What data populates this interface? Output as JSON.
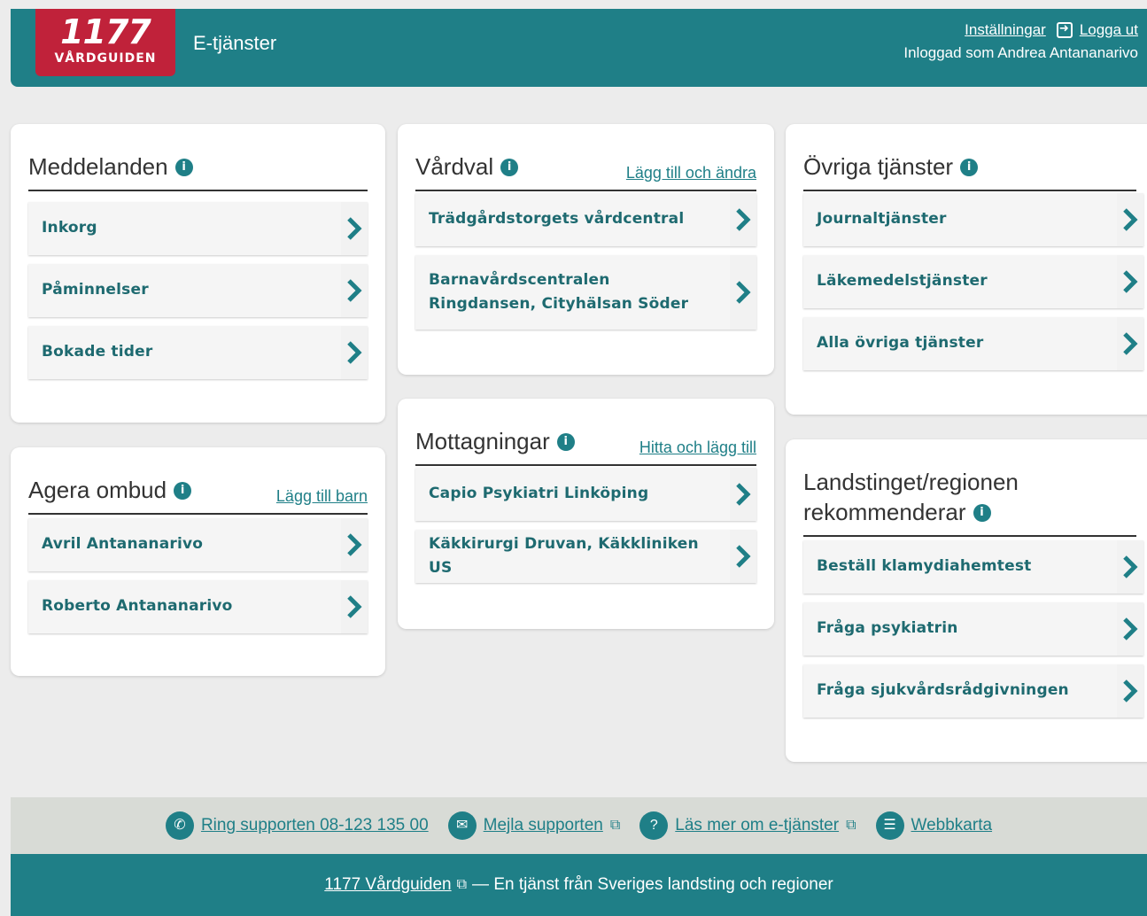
{
  "header": {
    "logo_number": "1177",
    "logo_text": "VÅRDGUIDEN",
    "app_title": "E-tjänster",
    "settings_link": "Inställningar",
    "logout_link": "Logga ut",
    "logged_in_text": "Inloggad som Andrea Antananarivo"
  },
  "messages": {
    "title": "Meddelanden",
    "items": [
      "Inkorg",
      "Påminnelser",
      "Bokade tider"
    ]
  },
  "proxy": {
    "title": "Agera ombud",
    "link": "Lägg till barn",
    "items": [
      "Avril Antananarivo",
      "Roberto Antananarivo"
    ]
  },
  "care_choice": {
    "title": "Vårdval",
    "link": "Lägg till och ändra",
    "items": [
      "Trädgårdstorgets vårdcentral",
      "Barnavårdscentralen Ringdansen, Cityhälsan Söder"
    ]
  },
  "clinics": {
    "title": "Mottagningar",
    "link": "Hitta och lägg till",
    "items": [
      "Capio Psykiatri Linköping",
      "Käkkirurgi Druvan, Käkkliniken US"
    ]
  },
  "other_services": {
    "title": "Övriga tjänster",
    "items": [
      "Journaltjänster",
      "Läkemedelstjänster",
      "Alla övriga tjänster"
    ]
  },
  "region": {
    "title_line1": "Landstinget/regionen",
    "title_line2": "rekommenderar",
    "items": [
      "Beställ klamydiahemtest",
      "Fråga psykiatrin",
      "Fråga sjukvårdsrådgivningen"
    ]
  },
  "footer": {
    "call_support": "Ring supporten 08-123 135 00",
    "email_support": "Mejla supporten",
    "read_more": "Läs mer om e-tjänster",
    "sitemap": "Webbkarta",
    "brand_link": "1177 Vårdguiden",
    "tagline": "— En tjänst från Sveriges landsting och regioner"
  },
  "colors": {
    "primary": "#1f7f87",
    "brand_red": "#c0223a",
    "background": "#ececec"
  }
}
